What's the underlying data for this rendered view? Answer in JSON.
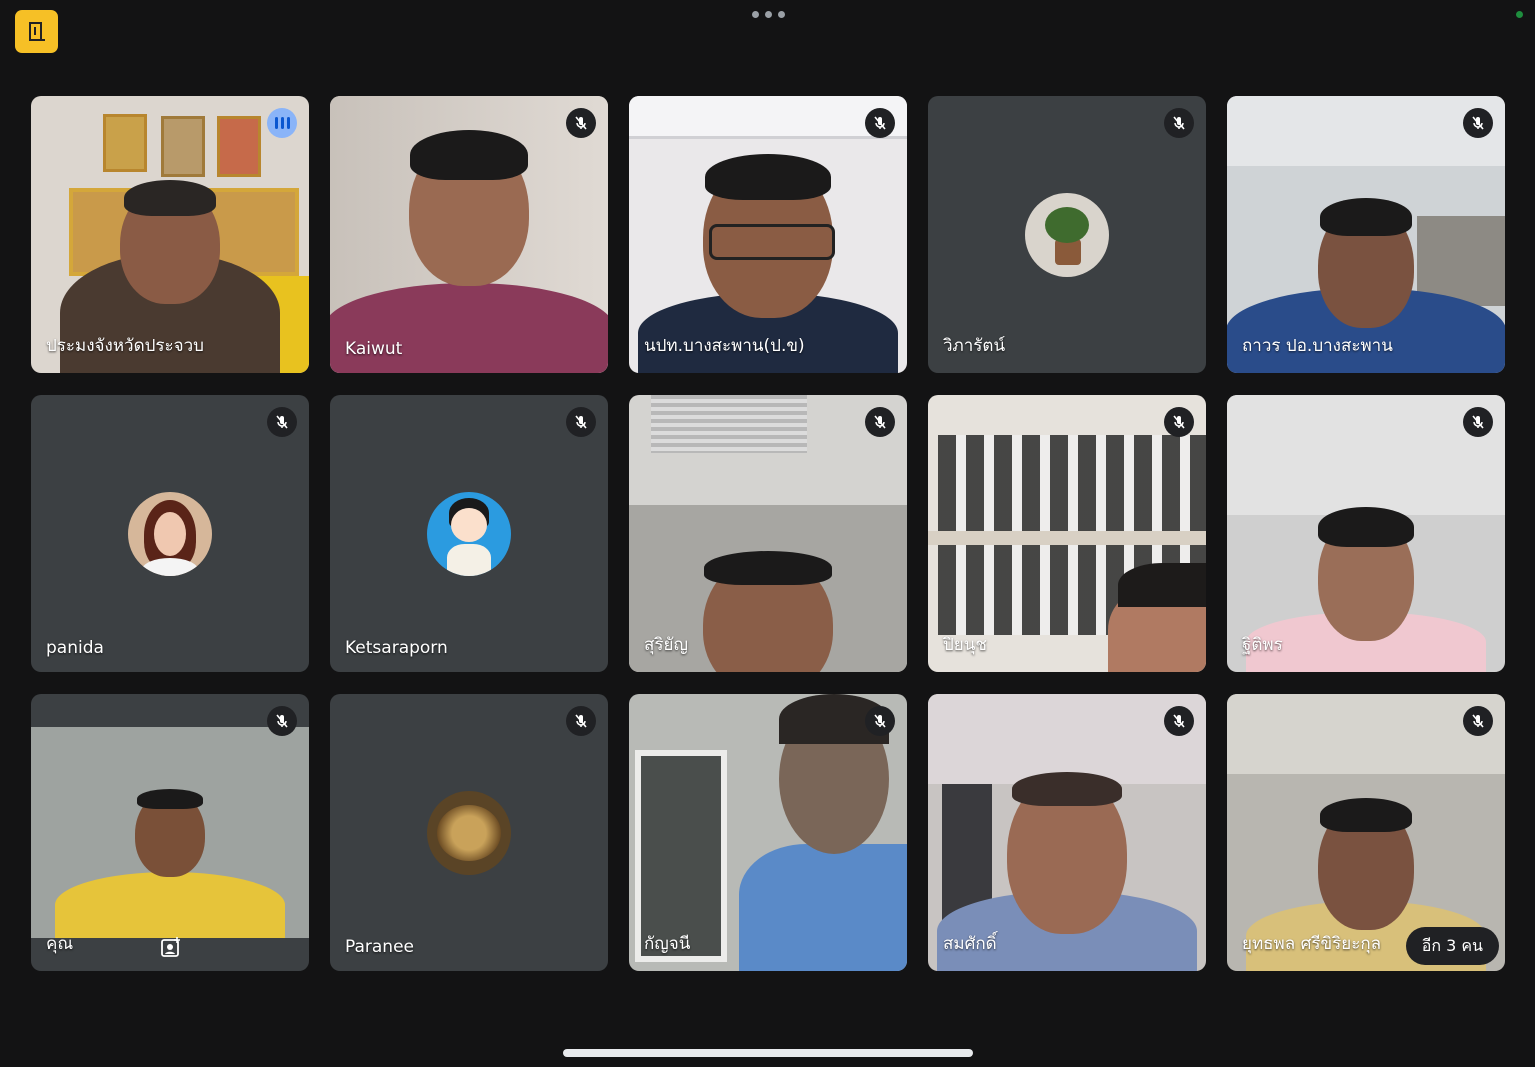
{
  "colors": {
    "background": "#131314",
    "tile": "#3c4043",
    "accent": "#f6c026",
    "speaking": "#8ab4f8"
  },
  "top_bar": {
    "logo_icon": "door-exit-icon",
    "menu_icon": "more-horizontal-icon",
    "status_icon": "recording-dot-icon"
  },
  "participants": [
    {
      "name": "ประมงจังหวัดประจวบ",
      "mic": "speaking",
      "video": true
    },
    {
      "name": "Kaiwut",
      "mic": "muted",
      "video": true
    },
    {
      "name": "นปท.บางสะพาน(ป.ข)",
      "mic": "muted",
      "video": true
    },
    {
      "name": "วิภารัตน์",
      "mic": "muted",
      "video": false,
      "avatar": "plant"
    },
    {
      "name": "ถาวร ปอ.บางสะพาน",
      "mic": "muted",
      "video": true
    },
    {
      "name": "panida",
      "mic": "muted",
      "video": false,
      "avatar": "woman-photo"
    },
    {
      "name": "Ketsaraporn",
      "mic": "muted",
      "video": false,
      "avatar": "cartoon-girl"
    },
    {
      "name": "สุริยัญ",
      "mic": "muted",
      "video": true
    },
    {
      "name": "ปิยนุช",
      "mic": "muted",
      "video": true
    },
    {
      "name": "ฐิติพร",
      "mic": "muted",
      "video": true
    },
    {
      "name": "คุณ",
      "mic": "muted",
      "video": true,
      "self": true
    },
    {
      "name": "Paranee",
      "mic": "muted",
      "video": false,
      "avatar": "dried-fish"
    },
    {
      "name": "กัญจนี",
      "mic": "muted",
      "video": true
    },
    {
      "name": "สมศักดิ์",
      "mic": "muted",
      "video": true
    },
    {
      "name": "ยุทธพล ศรีขิริยะกุล",
      "mic": "muted",
      "video": true
    }
  ],
  "overflow_label": "อีก 3 คน"
}
